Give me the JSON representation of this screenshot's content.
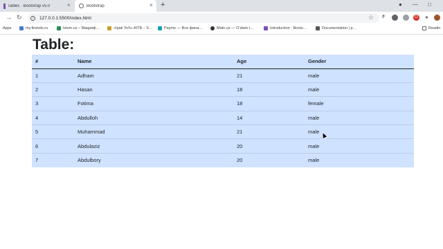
{
  "browser": {
    "tabs": [
      {
        "title": "Tables · Bootstrap v5.0"
      },
      {
        "title": "Bootstrap"
      }
    ],
    "url": "127.0.0.1:5500/index.html",
    "new_tab_symbol": "+",
    "window_controls": {
      "minimize": "—",
      "maximize": "□"
    },
    "icons": [
      "back-icon",
      "forward-icon",
      "reload-icon",
      "info-icon",
      "star-icon",
      "close-icon"
    ],
    "extension_labels": {
      "f": "f⁷",
      "opera": "O"
    }
  },
  "bookmarks": {
    "apps": "Apps",
    "items": [
      {
        "label": "my.firstvds.ru",
        "color": "#4a7bd0"
      },
      {
        "label": "Islom.uz – Мақриф…",
        "color": "#2e8b57"
      },
      {
        "label": "«Ipak Yo'li» AITB – S…",
        "color": "#c8a02c"
      },
      {
        "label": "Payme — Все фина…",
        "color": "#1ba0b5"
      },
      {
        "label": "Matn.uz — O'zbek t…",
        "color": "#333333"
      },
      {
        "label": "Introduction · Boots…",
        "color": "#7952b3"
      },
      {
        "label": "Documentation | p…",
        "color": "#555555"
      }
    ],
    "reading_list": "Readin"
  },
  "page": {
    "title": "Table:",
    "table": {
      "headers": [
        "#",
        "Name",
        "Age",
        "Gender"
      ],
      "rows": [
        [
          "1",
          "Adham",
          "21",
          "male"
        ],
        [
          "2",
          "Hasan",
          "18",
          "male"
        ],
        [
          "3",
          "Fotima",
          "18",
          "female"
        ],
        [
          "4",
          "Abdulloh",
          "14",
          "male"
        ],
        [
          "5",
          "Muhammad",
          "21",
          "male"
        ],
        [
          "6",
          "Abdulaziz",
          "20",
          "male"
        ],
        [
          "7",
          "Abdulbory",
          "20",
          "male"
        ]
      ]
    }
  },
  "colors": {
    "table_bg": "#cfe2ff",
    "tab_strip": "#dee1e6"
  }
}
